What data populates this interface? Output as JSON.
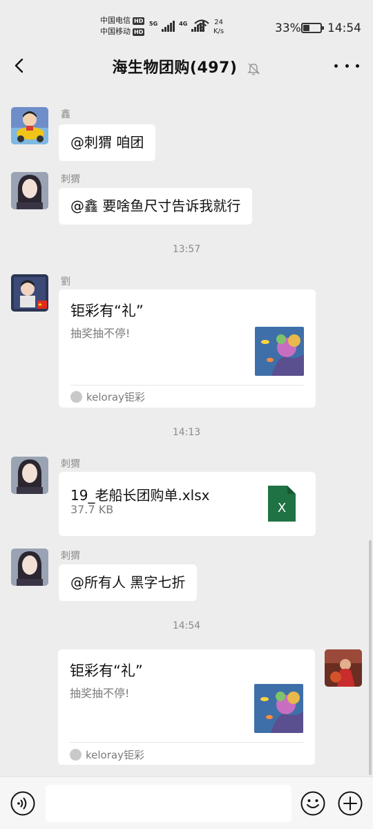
{
  "status_bar": {
    "carrier1": "中国电信",
    "carrier2": "中国移动",
    "hd_badge": "HD",
    "sig1_label": "5G",
    "sig2_label": "4G",
    "speed_value": "24",
    "speed_unit": "K/s",
    "battery_percent": "33%",
    "battery_level": 0.33,
    "time": "14:54"
  },
  "header": {
    "title": "海生物团购(497)"
  },
  "messages": [
    {
      "sender": "鑫",
      "text": "@刺猬  咱团"
    },
    {
      "sender": "刺猬",
      "text": "@鑫  要啥鱼尺寸告诉我就行"
    },
    {
      "timestamp": "13:57"
    },
    {
      "sender": "劉",
      "card": {
        "title": "钜彩有“礼”",
        "desc": "抽奖抽不停!",
        "source": "keloray钜彩"
      }
    },
    {
      "timestamp": "14:13"
    },
    {
      "sender": "刺猬",
      "file": {
        "name": "19_老船长团购单.xlsx",
        "size": "37.7 KB",
        "icon_letter": "X"
      }
    },
    {
      "sender": "刺猬",
      "text": "@所有人  黑字七折"
    },
    {
      "timestamp": "14:54"
    },
    {
      "sender": "",
      "card": {
        "title": "钜彩有“礼”",
        "desc": "抽奖抽不停!",
        "source": "keloray钜彩"
      }
    }
  ],
  "input_bar": {
    "placeholder": "",
    "value": ""
  },
  "colors": {
    "background": "#ededed",
    "bubble": "#ffffff",
    "excel_green": "#1f7244"
  }
}
